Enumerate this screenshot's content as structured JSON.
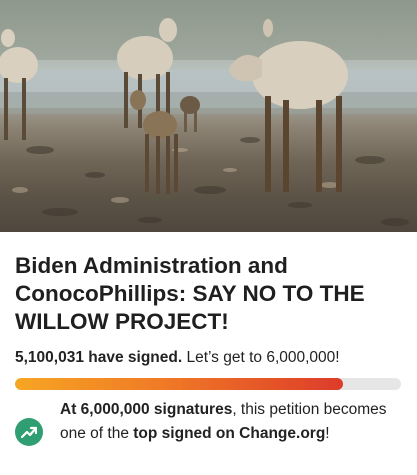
{
  "hero": {
    "image_alt": ""
  },
  "petition": {
    "title": "Biden Administration and ConocoPhillips: SAY NO TO THE WILLOW PROJECT!",
    "signatures": {
      "count_text": "5,100,031 have signed.",
      "goal_text": "Let’s get to 6,000,000!"
    },
    "progress": {
      "current": 5100031,
      "goal": 6000000,
      "fraction": 0.85
    },
    "milestone": {
      "icon": "trending-up-icon",
      "part1_bold": "At 6,000,000 signatures",
      "part2": ", this petition becomes one of the ",
      "part3_bold": "top signed on Change.org",
      "part4": "!"
    }
  },
  "colors": {
    "progress_start": "#f6a623",
    "progress_end": "#dd3b2a",
    "progress_track": "#e6e6e6",
    "milestone_icon_bg": "#2f9e72"
  }
}
